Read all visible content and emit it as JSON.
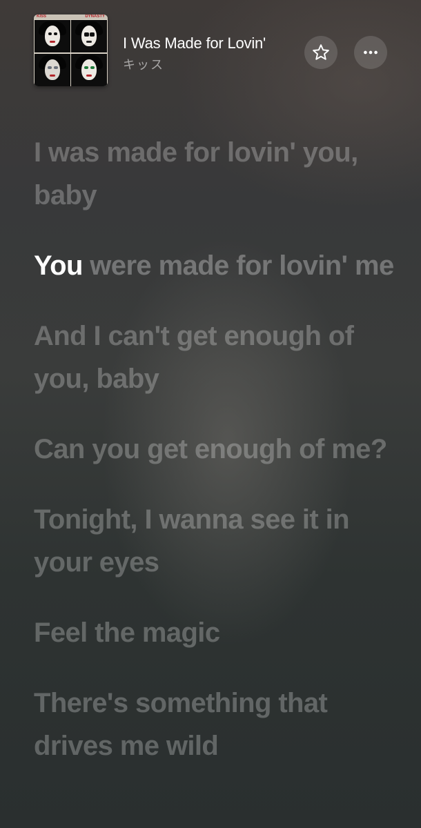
{
  "now_playing": {
    "album": {
      "band_logo": "KISS",
      "album_title": "DYNASTY"
    },
    "song_title": "I Was Made for Lovin'",
    "artist": "キッス"
  },
  "actions": {
    "favorite_icon": "star-icon",
    "more_icon": "ellipsis-icon"
  },
  "lyrics": [
    {
      "text": "I was made for lovin' you, baby"
    },
    {
      "sung": "You",
      "rest": " were made for lovin' me"
    },
    {
      "text": "And I can't get enough of you, baby"
    },
    {
      "text": "Can you get enough of me?"
    },
    {
      "text": "Tonight, I wanna see it in your eyes"
    },
    {
      "text": "Feel the magic"
    },
    {
      "text": "There's something that drives me wild"
    }
  ]
}
